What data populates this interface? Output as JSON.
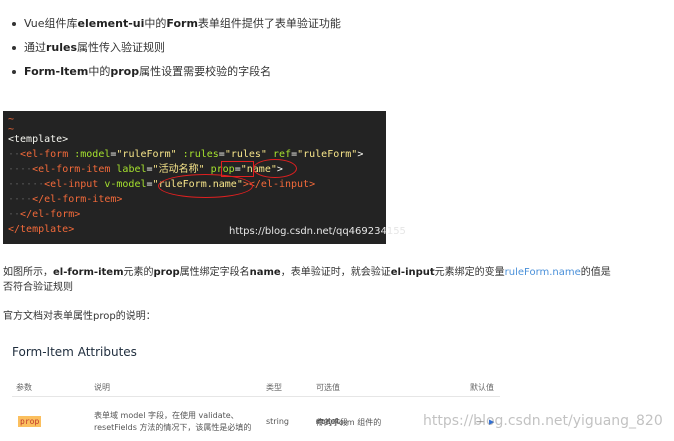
{
  "bullets": [
    {
      "pre": "Vue组件库",
      "b1": "element-ui",
      "mid": "中的",
      "b2": "Form",
      "post": "表单组件提供了表单验证功能"
    },
    {
      "pre": "通过",
      "b1": "rules",
      "post": "属性传入验证规则"
    },
    {
      "b1": "Form-Item",
      "mid": "中的",
      "b2": "prop",
      "post": "属性设置需要校验的字段名"
    }
  ],
  "code": {
    "tilde": "~",
    "l1": "<template>",
    "l2_dots": "··",
    "l2_tag_open": "<el-form",
    "l2_a1": ":model",
    "l2_v1": "\"ruleForm\"",
    "l2_a2": ":rules",
    "l2_v2": "\"rules\"",
    "l2_a3": "ref",
    "l2_v3": "\"ruleForm\"",
    "l2_close": ">",
    "l3_dots": "····",
    "l3_tag": "<el-form-item",
    "l3_a1": "label",
    "l3_v1": "\"活动名称\"",
    "l3_a2": "prop",
    "l3_v2": "\"name\"",
    "l3_close": ">",
    "l4_dots": "······",
    "l4_tag": "<el-input",
    "l4_a1": "v-model",
    "l4_v1": "\"ruleForm.name\"",
    "l4_close": "></el-input>",
    "l5_dots": "····",
    "l5": "</el-form-item>",
    "l6_dots": "··",
    "l6": "</el-form>",
    "l7": "</template>",
    "watermark": "https://blog.csdn.net/qq469234155"
  },
  "para": {
    "p1": "如图所示，",
    "b1": "el-form-item",
    "p2": "元素的",
    "b2": "prop",
    "p3": "属性绑定字段名",
    "b3": "name",
    "p4": "，表单验证时，就会验证",
    "b4": "el-input",
    "p5": "元素绑定的变量",
    "link": "ruleForm.name",
    "p6": "的值是否符合验证规则"
  },
  "intro": "官方文档对表单属性prop的说明：",
  "attributes": {
    "title": "Form-Item Attributes",
    "headers": [
      "参数",
      "说明",
      "类型",
      "可选值",
      "默认值"
    ],
    "row": {
      "param": "prop",
      "desc": "表单域 model 字段，在使用 validate、resetFields 方法的情况下，该属性是必填的",
      "type": "string",
      "options_pre": "传入 Form 组件的",
      "options_code": "model",
      "options_post": "中的字段",
      "default": "—"
    }
  },
  "watermark2": "https://blog.csdn.net/yiguang_820",
  "colors": {
    "tag": "#f36a3a",
    "attr": "#a6e22e",
    "string": "#f7e58a",
    "annotation": "#e02020",
    "link": "#4a90d9",
    "badge": "#fbbf5e"
  }
}
